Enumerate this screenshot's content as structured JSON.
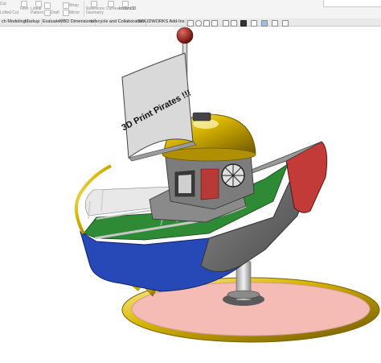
{
  "ribbon": {
    "items": [
      {
        "label": "Cut"
      },
      {
        "label": "Fillet"
      },
      {
        "label": "Linear Pattern"
      },
      {
        "label": "Draft"
      },
      {
        "label": "Wrap"
      },
      {
        "label": "Reference Geometry"
      },
      {
        "label": "Curves"
      },
      {
        "label": "Instant3D"
      },
      {
        "label": "Lofted Cut"
      },
      {
        "label": "Shell"
      },
      {
        "label": "Mirror"
      },
      {
        "label": "Boundary Cut"
      }
    ]
  },
  "tabs": [
    {
      "label": "ch Modeling"
    },
    {
      "label": "Markup"
    },
    {
      "label": "Evaluate"
    },
    {
      "label": "MBD Dimensions"
    },
    {
      "label": "Lifecycle and Collaboration"
    },
    {
      "label": "SOLIDWORKS Add-Ins"
    }
  ],
  "model": {
    "flag_text": "3D Print Pirates !!!"
  },
  "colors": {
    "hull_blue": "#2749b8",
    "hull_grey": "#6f6f6f",
    "hull_red": "#c23b38",
    "deck_green": "#2f8a35",
    "cabin_grey": "#7c7c7c",
    "dome_gold": "#d7b400",
    "window_red": "#b83a36",
    "flag_grey": "#d9d9d9",
    "ball_red": "#a5231e",
    "base_pink": "#f4bcb4",
    "base_gold": "#c9a200",
    "chrome": "#c8c8c8"
  },
  "icons": [
    "pin-icon",
    "search-view-icon",
    "zoom-area-icon",
    "previous-view-icon",
    "section-view-icon",
    "view-orientation-icon",
    "display-style-icon",
    "hide-show-icon",
    "appearance-icon",
    "scene-icon",
    "view-settings-icon"
  ]
}
